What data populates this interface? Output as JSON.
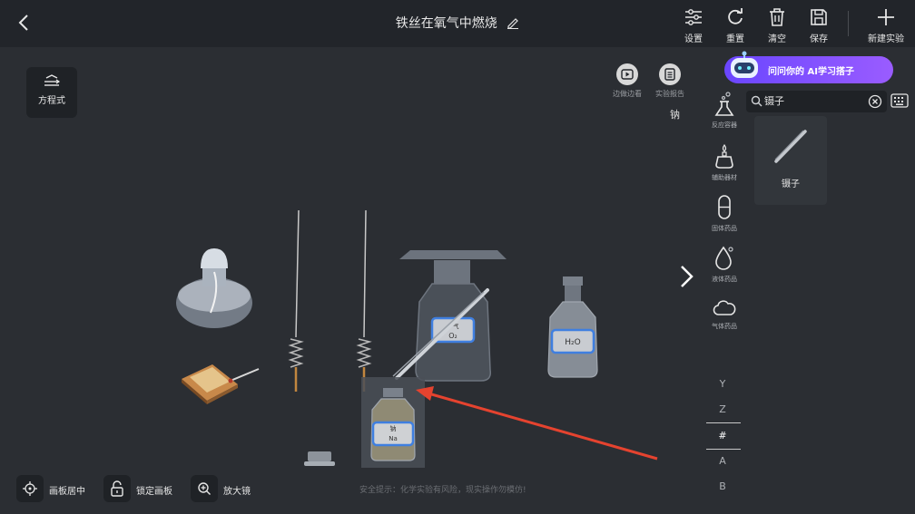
{
  "header": {
    "title": "铁丝在氧气中燃烧",
    "toolbar": [
      {
        "label": "设置",
        "icon": "sliders-icon"
      },
      {
        "label": "重置",
        "icon": "refresh-icon"
      },
      {
        "label": "清空",
        "icon": "trash-icon"
      },
      {
        "label": "保存",
        "icon": "save-icon"
      },
      {
        "label": "新建实验",
        "icon": "plus-icon"
      }
    ]
  },
  "left_panel": {
    "equation_label": "方程式"
  },
  "top_right": {
    "watch_label": "边做边看",
    "report_label": "实验报告",
    "selected_item": "钠"
  },
  "ai_banner": {
    "text": "问问你的 AI学习搭子"
  },
  "categories": [
    {
      "label": "反应容器",
      "icon": "flask-icon"
    },
    {
      "label": "辅助器材",
      "icon": "burner-icon"
    },
    {
      "label": "固体药品",
      "icon": "capsule-icon"
    },
    {
      "label": "液体药品",
      "icon": "droplet-icon"
    },
    {
      "label": "气体药品",
      "icon": "cloud-icon"
    }
  ],
  "search": {
    "value": "镊子"
  },
  "results": [
    {
      "label": "镊子"
    }
  ],
  "alphabet": [
    "Y",
    "Z",
    "#",
    "A",
    "B"
  ],
  "alphabet_active": "#",
  "bottom": {
    "center_label": "画板居中",
    "lock_label": "锁定画板",
    "zoom_label": "放大镜",
    "safety_tip": "安全提示：化学实验有风险，现实操作勿模仿!"
  },
  "bottles": {
    "oxygen_label_1": "气",
    "oxygen_label_2": "O₂",
    "water_label": "H₂O",
    "sodium_label_1": "钠",
    "sodium_label_2": "Na"
  },
  "colors": {
    "background": "#2b2e33",
    "header": "#22252a",
    "label_border": "#3f7fe0",
    "arrow": "#e5432f",
    "ai_banner": "#7b4dff"
  }
}
